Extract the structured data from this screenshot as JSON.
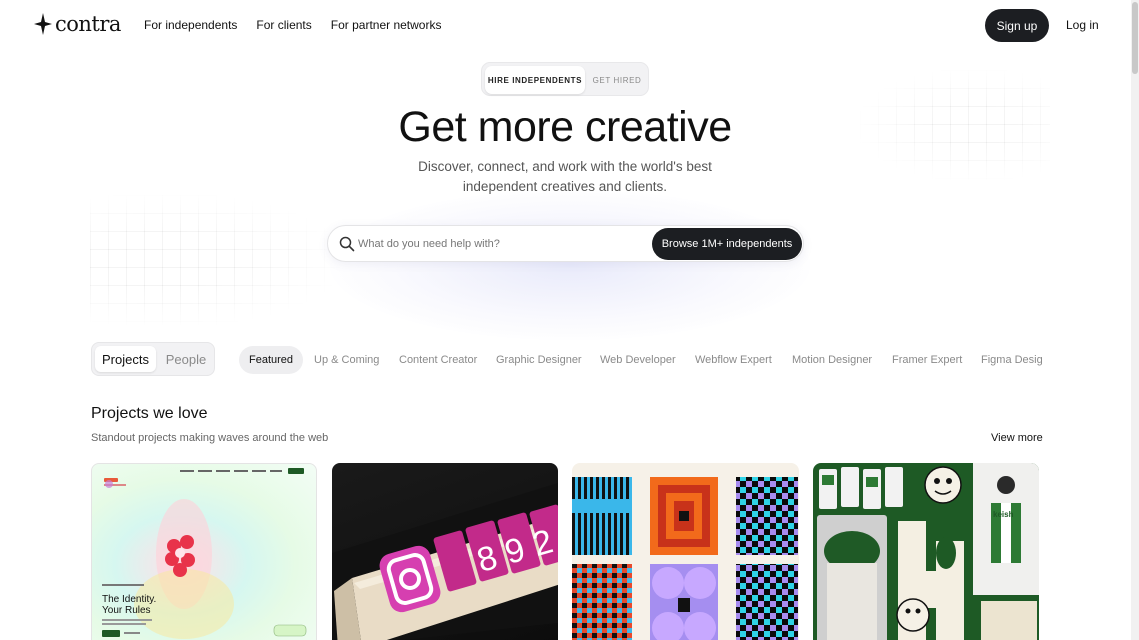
{
  "brand": {
    "name": "contra"
  },
  "nav": {
    "links": [
      "For independents",
      "For clients",
      "For partner networks"
    ],
    "signup": "Sign up",
    "login": "Log in"
  },
  "hero": {
    "toggle": {
      "active": "HIRE INDEPENDENTS",
      "inactive": "GET HIRED"
    },
    "title": "Get more creative",
    "subtitle_line1": "Discover, connect, and work with the world's best",
    "subtitle_line2": "independent creatives and clients."
  },
  "search": {
    "placeholder": "What do you need help with?",
    "button": "Browse 1M+ independents"
  },
  "filters": {
    "segment": {
      "active": "Projects",
      "inactive": "People"
    },
    "categories": [
      "Featured",
      "Up & Coming",
      "Content Creator",
      "Graphic Designer",
      "Web Developer",
      "Webflow Expert",
      "Motion Designer",
      "Framer Expert",
      "Figma Design"
    ]
  },
  "section": {
    "title": "Projects we love",
    "subtitle": "Standout projects making waves around the web",
    "view_more": "View more"
  },
  "cards": {
    "card1": {
      "headline_line1": "The Identity.",
      "headline_line2": "Your Rules"
    },
    "card2": {
      "digits": "892"
    },
    "card4": {
      "brand": "keish"
    }
  },
  "colors": {
    "primary_dark": "#1c1e22",
    "muted_text": "#8a8a8a",
    "card4_green": "#1e5a25"
  }
}
